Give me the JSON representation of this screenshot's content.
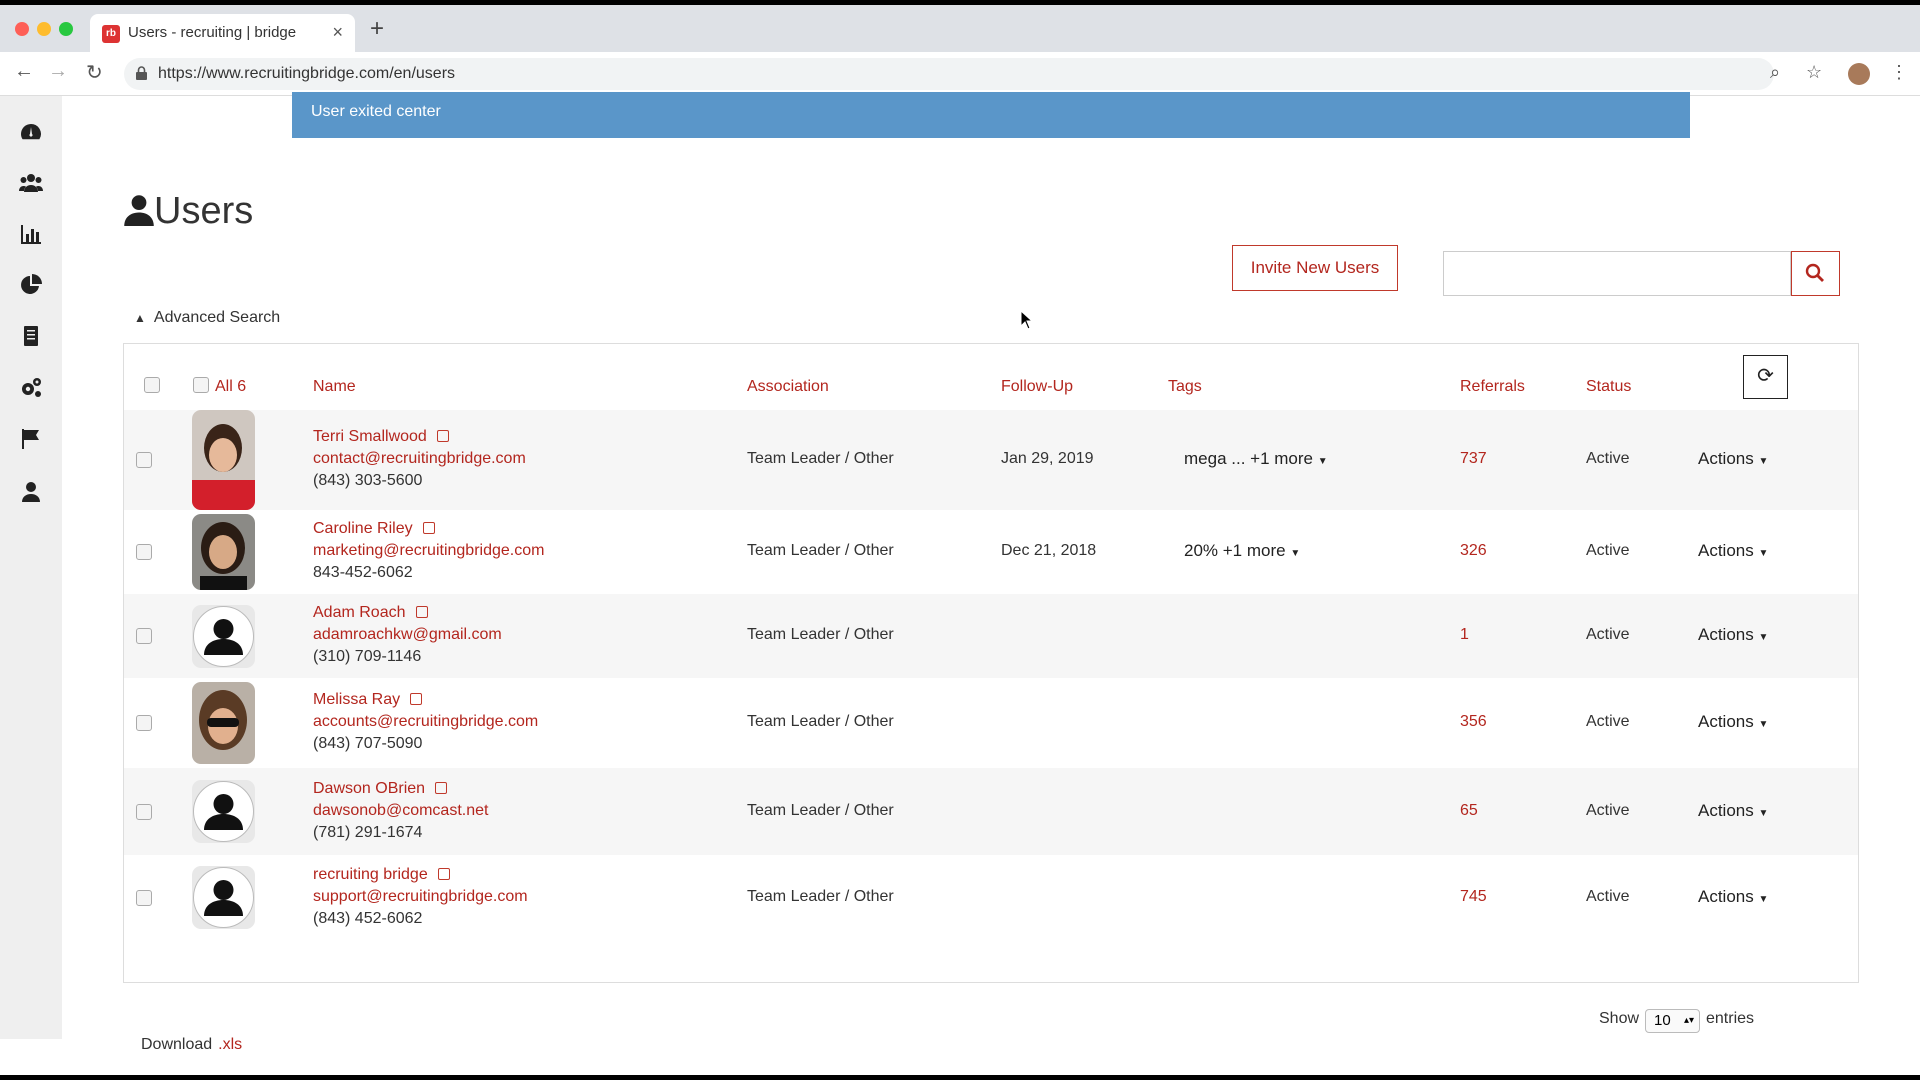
{
  "browser": {
    "tab_title": "Users - recruiting | bridge",
    "favicon_text": "rb",
    "url": "https://www.recruitingbridge.com/en/users"
  },
  "banner": {
    "text": "User exited center"
  },
  "page": {
    "title": "Users",
    "invite_label": "Invite New Users",
    "advanced_search_label": "Advanced Search"
  },
  "table": {
    "all_label": "All 6",
    "columns": [
      "Name",
      "Association",
      "Follow-Up",
      "Tags",
      "Referrals",
      "Status"
    ],
    "rows": [
      {
        "name": "Terri Smallwood",
        "email": "contact@recruitingbridge.com",
        "phone": "(843) 303-5600",
        "association": "Team Leader / Other",
        "followup": "Jan 29, 2019",
        "tags": "mega ... +1 more",
        "referrals": "737",
        "status": "Active",
        "actions": "Actions",
        "avatar": "photo-red"
      },
      {
        "name": "Caroline Riley",
        "email": "marketing@recruitingbridge.com",
        "phone": "843-452-6062",
        "association": "Team Leader / Other",
        "followup": "Dec 21, 2018",
        "tags": "20% +1 more",
        "referrals": "326",
        "status": "Active",
        "actions": "Actions",
        "avatar": "photo-dark"
      },
      {
        "name": "Adam Roach",
        "email": "adamroachkw@gmail.com",
        "phone": "(310) 709-1146",
        "association": "Team Leader / Other",
        "followup": "",
        "tags": "",
        "referrals": "1",
        "status": "Active",
        "actions": "Actions",
        "avatar": "placeholder"
      },
      {
        "name": "Melissa Ray",
        "email": "accounts@recruitingbridge.com",
        "phone": "(843) 707-5090",
        "association": "Team Leader / Other",
        "followup": "",
        "tags": "",
        "referrals": "356",
        "status": "Active",
        "actions": "Actions",
        "avatar": "photo-sun"
      },
      {
        "name": "Dawson OBrien",
        "email": "dawsonob@comcast.net",
        "phone": "(781) 291-1674",
        "association": "Team Leader / Other",
        "followup": "",
        "tags": "",
        "referrals": "65",
        "status": "Active",
        "actions": "Actions",
        "avatar": "placeholder"
      },
      {
        "name": "recruiting bridge",
        "email": "support@recruitingbridge.com",
        "phone": "(843) 452-6062",
        "association": "Team Leader / Other",
        "followup": "",
        "tags": "",
        "referrals": "745",
        "status": "Active",
        "actions": "Actions",
        "avatar": "placeholder"
      }
    ]
  },
  "footer": {
    "show_label": "Show",
    "page_size": "10",
    "entries_label": "entries",
    "download_label": "Download",
    "download_ext": ".xls"
  },
  "sidebar_icons": [
    "dashboard-icon",
    "people-icon",
    "bar-chart-icon",
    "pie-chart-icon",
    "document-icon",
    "gears-icon",
    "flag-icon",
    "user-icon"
  ],
  "colors": {
    "accent": "#b3261e",
    "banner": "#5a96c9"
  }
}
